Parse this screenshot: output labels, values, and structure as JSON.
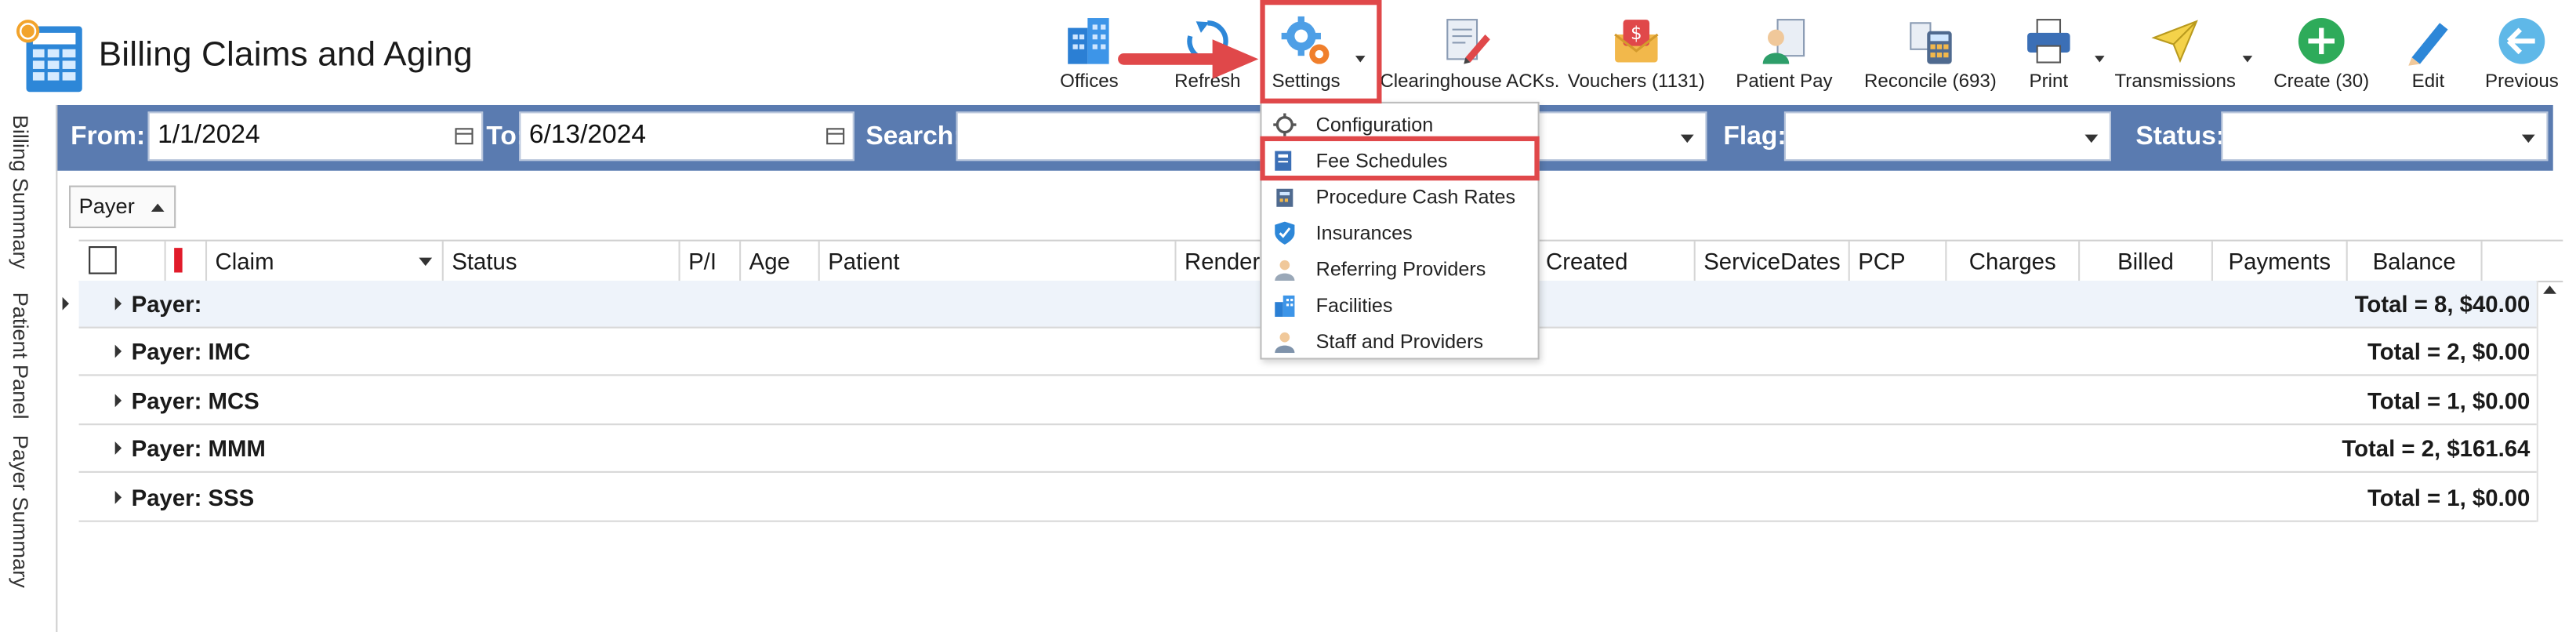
{
  "app": {
    "title": "Billing Claims and Aging"
  },
  "toolbar": {
    "buttons": [
      {
        "label": "Offices",
        "icon": "offices-icon"
      },
      {
        "label": "Refresh",
        "icon": "refresh-icon"
      },
      {
        "label": "Settings",
        "icon": "settings-gears-icon"
      },
      {
        "label": "Clearinghouse ACKs.",
        "icon": "clearinghouse-acks-icon"
      },
      {
        "label": "Vouchers (1131)",
        "icon": "vouchers-icon"
      },
      {
        "label": "Patient Pay",
        "icon": "patient-pay-icon"
      },
      {
        "label": "Reconcile (693)",
        "icon": "reconcile-icon"
      },
      {
        "label": "Print",
        "icon": "printer-icon"
      },
      {
        "label": "Transmissions",
        "icon": "transmissions-icon"
      },
      {
        "label": "Create (30)",
        "icon": "create-plus-icon"
      },
      {
        "label": "Edit",
        "icon": "edit-pencil-icon"
      },
      {
        "label": "Previous",
        "icon": "previous-arrow-icon"
      }
    ]
  },
  "filters": {
    "from_label": "From:",
    "from_value": "1/1/2024",
    "to_label": "To:",
    "to_value": "6/13/2024",
    "search_label": "Search:",
    "search_value": "",
    "flag_label": "Flag:",
    "flag_value": "",
    "status_label": "Status:",
    "status_value": ""
  },
  "side_tabs": [
    "Billing Summary",
    "Patient Panel",
    "Payer Summary"
  ],
  "grouping": {
    "chip_label": "Payer"
  },
  "grid": {
    "columns": [
      "Claim",
      "Status",
      "P/I",
      "Age",
      "Patient",
      "Render",
      "Created",
      "ServiceDates",
      "PCP",
      "Charges",
      "Billed",
      "Payments",
      "Balance"
    ],
    "rows": [
      {
        "label": "Payer:",
        "total": "Total = 8,  $40.00",
        "selected": true
      },
      {
        "label": "Payer: IMC",
        "total": "Total = 2,  $0.00",
        "selected": false
      },
      {
        "label": "Payer: MCS",
        "total": "Total = 1,  $0.00",
        "selected": false
      },
      {
        "label": "Payer: MMM",
        "total": "Total = 2,  $161.64",
        "selected": false
      },
      {
        "label": "Payer: SSS",
        "total": "Total = 1,  $0.00",
        "selected": false
      }
    ]
  },
  "settings_menu": {
    "items": [
      {
        "label": "Configuration",
        "icon": "configuration-gear-icon"
      },
      {
        "label": "Fee Schedules",
        "icon": "fee-schedules-icon"
      },
      {
        "label": "Procedure Cash Rates",
        "icon": "procedure-cash-rates-icon"
      },
      {
        "label": "Insurances",
        "icon": "insurances-shield-icon"
      },
      {
        "label": "Referring Providers",
        "icon": "referring-providers-icon"
      },
      {
        "label": "Facilities",
        "icon": "facilities-icon"
      },
      {
        "label": "Staff and Providers",
        "icon": "staff-providers-icon"
      }
    ]
  },
  "colors": {
    "filter_bar": "#5a7bb0",
    "highlight": "#e0484a",
    "flag": "#e11b2a"
  }
}
